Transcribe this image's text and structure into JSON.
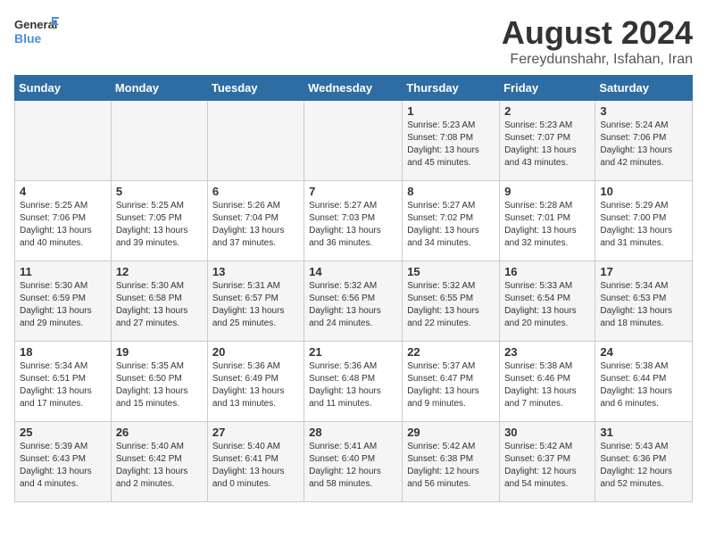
{
  "logo": {
    "line1": "General",
    "line2": "Blue"
  },
  "title": "August 2024",
  "location": "Fereydunshahr, Isfahan, Iran",
  "days_header": [
    "Sunday",
    "Monday",
    "Tuesday",
    "Wednesday",
    "Thursday",
    "Friday",
    "Saturday"
  ],
  "weeks": [
    [
      {
        "day": "",
        "info": ""
      },
      {
        "day": "",
        "info": ""
      },
      {
        "day": "",
        "info": ""
      },
      {
        "day": "",
        "info": ""
      },
      {
        "day": "1",
        "info": "Sunrise: 5:23 AM\nSunset: 7:08 PM\nDaylight: 13 hours\nand 45 minutes."
      },
      {
        "day": "2",
        "info": "Sunrise: 5:23 AM\nSunset: 7:07 PM\nDaylight: 13 hours\nand 43 minutes."
      },
      {
        "day": "3",
        "info": "Sunrise: 5:24 AM\nSunset: 7:06 PM\nDaylight: 13 hours\nand 42 minutes."
      }
    ],
    [
      {
        "day": "4",
        "info": "Sunrise: 5:25 AM\nSunset: 7:06 PM\nDaylight: 13 hours\nand 40 minutes."
      },
      {
        "day": "5",
        "info": "Sunrise: 5:25 AM\nSunset: 7:05 PM\nDaylight: 13 hours\nand 39 minutes."
      },
      {
        "day": "6",
        "info": "Sunrise: 5:26 AM\nSunset: 7:04 PM\nDaylight: 13 hours\nand 37 minutes."
      },
      {
        "day": "7",
        "info": "Sunrise: 5:27 AM\nSunset: 7:03 PM\nDaylight: 13 hours\nand 36 minutes."
      },
      {
        "day": "8",
        "info": "Sunrise: 5:27 AM\nSunset: 7:02 PM\nDaylight: 13 hours\nand 34 minutes."
      },
      {
        "day": "9",
        "info": "Sunrise: 5:28 AM\nSunset: 7:01 PM\nDaylight: 13 hours\nand 32 minutes."
      },
      {
        "day": "10",
        "info": "Sunrise: 5:29 AM\nSunset: 7:00 PM\nDaylight: 13 hours\nand 31 minutes."
      }
    ],
    [
      {
        "day": "11",
        "info": "Sunrise: 5:30 AM\nSunset: 6:59 PM\nDaylight: 13 hours\nand 29 minutes."
      },
      {
        "day": "12",
        "info": "Sunrise: 5:30 AM\nSunset: 6:58 PM\nDaylight: 13 hours\nand 27 minutes."
      },
      {
        "day": "13",
        "info": "Sunrise: 5:31 AM\nSunset: 6:57 PM\nDaylight: 13 hours\nand 25 minutes."
      },
      {
        "day": "14",
        "info": "Sunrise: 5:32 AM\nSunset: 6:56 PM\nDaylight: 13 hours\nand 24 minutes."
      },
      {
        "day": "15",
        "info": "Sunrise: 5:32 AM\nSunset: 6:55 PM\nDaylight: 13 hours\nand 22 minutes."
      },
      {
        "day": "16",
        "info": "Sunrise: 5:33 AM\nSunset: 6:54 PM\nDaylight: 13 hours\nand 20 minutes."
      },
      {
        "day": "17",
        "info": "Sunrise: 5:34 AM\nSunset: 6:53 PM\nDaylight: 13 hours\nand 18 minutes."
      }
    ],
    [
      {
        "day": "18",
        "info": "Sunrise: 5:34 AM\nSunset: 6:51 PM\nDaylight: 13 hours\nand 17 minutes."
      },
      {
        "day": "19",
        "info": "Sunrise: 5:35 AM\nSunset: 6:50 PM\nDaylight: 13 hours\nand 15 minutes."
      },
      {
        "day": "20",
        "info": "Sunrise: 5:36 AM\nSunset: 6:49 PM\nDaylight: 13 hours\nand 13 minutes."
      },
      {
        "day": "21",
        "info": "Sunrise: 5:36 AM\nSunset: 6:48 PM\nDaylight: 13 hours\nand 11 minutes."
      },
      {
        "day": "22",
        "info": "Sunrise: 5:37 AM\nSunset: 6:47 PM\nDaylight: 13 hours\nand 9 minutes."
      },
      {
        "day": "23",
        "info": "Sunrise: 5:38 AM\nSunset: 6:46 PM\nDaylight: 13 hours\nand 7 minutes."
      },
      {
        "day": "24",
        "info": "Sunrise: 5:38 AM\nSunset: 6:44 PM\nDaylight: 13 hours\nand 6 minutes."
      }
    ],
    [
      {
        "day": "25",
        "info": "Sunrise: 5:39 AM\nSunset: 6:43 PM\nDaylight: 13 hours\nand 4 minutes."
      },
      {
        "day": "26",
        "info": "Sunrise: 5:40 AM\nSunset: 6:42 PM\nDaylight: 13 hours\nand 2 minutes."
      },
      {
        "day": "27",
        "info": "Sunrise: 5:40 AM\nSunset: 6:41 PM\nDaylight: 13 hours\nand 0 minutes."
      },
      {
        "day": "28",
        "info": "Sunrise: 5:41 AM\nSunset: 6:40 PM\nDaylight: 12 hours\nand 58 minutes."
      },
      {
        "day": "29",
        "info": "Sunrise: 5:42 AM\nSunset: 6:38 PM\nDaylight: 12 hours\nand 56 minutes."
      },
      {
        "day": "30",
        "info": "Sunrise: 5:42 AM\nSunset: 6:37 PM\nDaylight: 12 hours\nand 54 minutes."
      },
      {
        "day": "31",
        "info": "Sunrise: 5:43 AM\nSunset: 6:36 PM\nDaylight: 12 hours\nand 52 minutes."
      }
    ]
  ]
}
